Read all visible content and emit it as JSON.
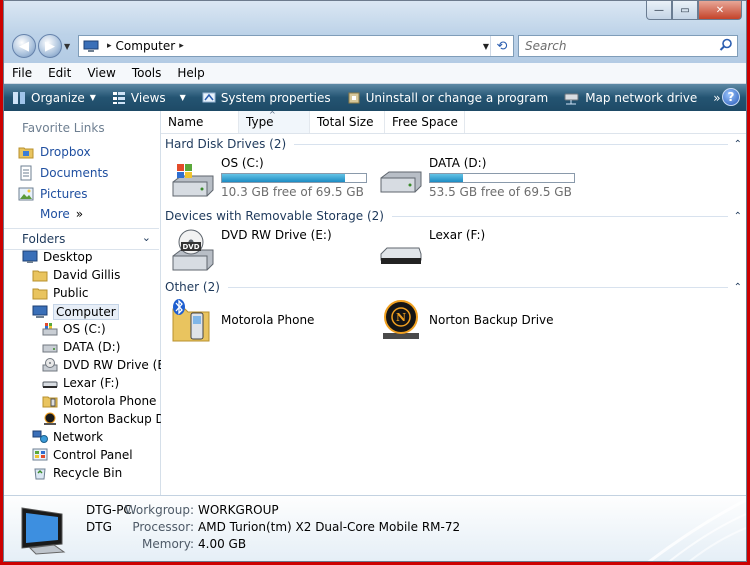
{
  "address": {
    "crumb": "Computer"
  },
  "search": {
    "placeholder": "Search"
  },
  "menu": [
    "File",
    "Edit",
    "View",
    "Tools",
    "Help"
  ],
  "toolbar": {
    "organize": "Organize",
    "views": "Views",
    "system_properties": "System properties",
    "uninstall": "Uninstall or change a program",
    "map_drive": "Map network drive",
    "more": "»",
    "help": "?"
  },
  "favorites": {
    "title": "Favorite Links",
    "items": [
      "Dropbox",
      "Documents",
      "Pictures"
    ],
    "more": "More",
    "more_glyph": "»"
  },
  "folders": {
    "title": "Folders",
    "tree": [
      "Desktop",
      "David Gillis",
      "Public",
      "Computer",
      "OS (C:)",
      "DATA (D:)",
      "DVD RW Drive (E:)",
      "Lexar (F:)",
      "Motorola Phone",
      "Norton Backup Driv",
      "Network",
      "Control Panel",
      "Recycle Bin"
    ]
  },
  "columns": [
    "Name",
    "Type",
    "Total Size",
    "Free Space"
  ],
  "groups": {
    "hdd": "Hard Disk Drives (2)",
    "removable": "Devices with Removable Storage (2)",
    "other": "Other (2)"
  },
  "drives": {
    "c": {
      "name": "OS (C:)",
      "free": "10.3 GB free of 69.5 GB",
      "used_fraction": 0.852
    },
    "d": {
      "name": "DATA (D:)",
      "free": "53.5 GB free of 69.5 GB",
      "used_fraction": 0.23
    },
    "e": {
      "name": "DVD RW Drive (E:)",
      "badge": "DVD"
    },
    "f": {
      "name": "Lexar (F:)"
    },
    "phone": {
      "name": "Motorola Phone"
    },
    "norton": {
      "name": "Norton Backup Drive",
      "badge": "N"
    }
  },
  "details": {
    "pc_name": "DTG-PC",
    "pc_short": "DTG",
    "workgroup_label": "Workgroup:",
    "workgroup": "WORKGROUP",
    "processor_label": "Processor:",
    "processor": "AMD Turion(tm) X2 Dual-Core Mobile RM-72",
    "memory_label": "Memory:",
    "memory": "4.00 GB"
  },
  "colors": {
    "accent": "#1d8bc3",
    "cmdbar": "#245472",
    "link": "#1f4fa0"
  }
}
